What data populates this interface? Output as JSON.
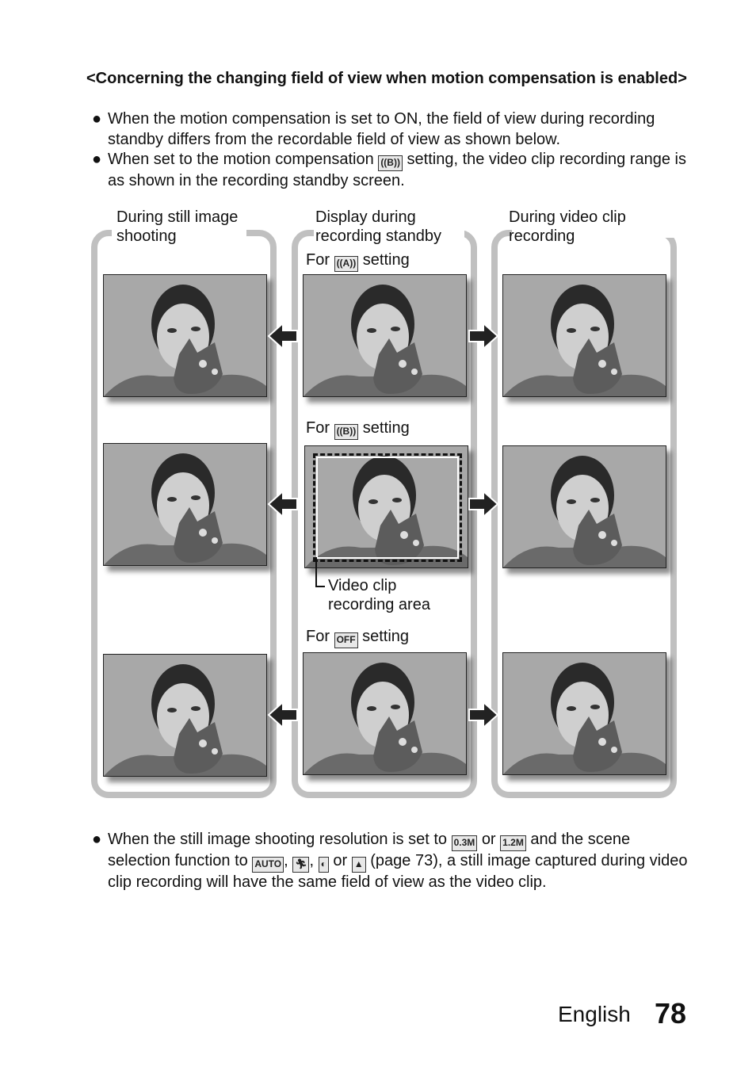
{
  "heading": "<Concerning the changing field of view when motion compensation is enabled>",
  "intro_bullets": [
    {
      "text": "When the motion compensation is set to ON, the field of view during recording standby differs from the recordable field of view as shown below."
    },
    {
      "before": "When set to the motion compensation",
      "icon": "motion-compensation-B",
      "icon_text": "((B))",
      "after": "setting, the video clip recording range is as shown in the recording standby screen."
    }
  ],
  "diagram": {
    "columns": [
      {
        "title": "During still image shooting"
      },
      {
        "title": "Display during recording standby"
      },
      {
        "title": "During video clip recording"
      }
    ],
    "rows": [
      {
        "label_before": "For",
        "icon": "motion-compensation-A",
        "icon_text": "((A))",
        "label_after": "setting"
      },
      {
        "label_before": "For",
        "icon": "motion-compensation-B",
        "icon_text": "((B))",
        "label_after": "setting"
      },
      {
        "label_before": "For",
        "icon": "motion-compensation-off",
        "icon_text": "OFF",
        "label_after": "setting"
      }
    ],
    "callout": "Video clip recording area"
  },
  "final_bullet": {
    "p1": "When the still image shooting resolution is set to",
    "res1": "0.3M",
    "or1": "or",
    "res2": "1.2M",
    "p2": "and the scene selection function to",
    "scene1": "AUTO",
    "scene2": "sports",
    "scene3": "portrait",
    "or2": "or",
    "scene4": "landscape",
    "p3": "(page 73), a still image captured during video clip recording will have the same field of view as the video clip."
  },
  "footer": {
    "language": "English",
    "page": "78"
  }
}
